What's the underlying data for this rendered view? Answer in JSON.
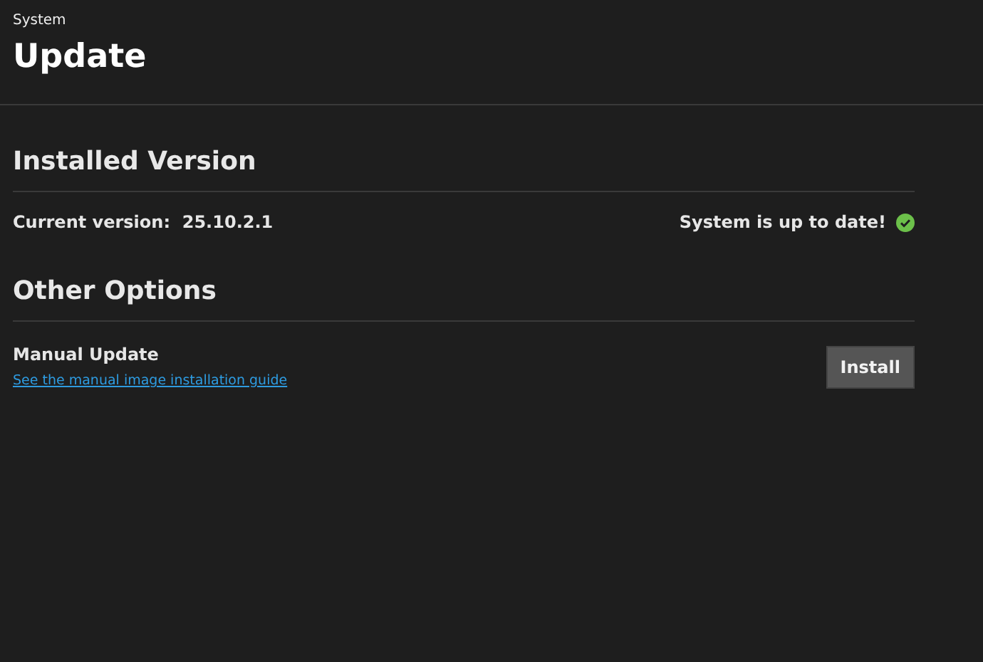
{
  "breadcrumb": "System",
  "title": "Update",
  "installed": {
    "heading": "Installed Version",
    "label": "Current version:",
    "version": "25.10.2.1",
    "status": {
      "text": "System is up to date!",
      "kind": "ok"
    }
  },
  "other": {
    "heading": "Other Options",
    "items": [
      {
        "title": "Manual Update",
        "link": "See the manual image installation guide",
        "button": "Install"
      }
    ]
  }
}
